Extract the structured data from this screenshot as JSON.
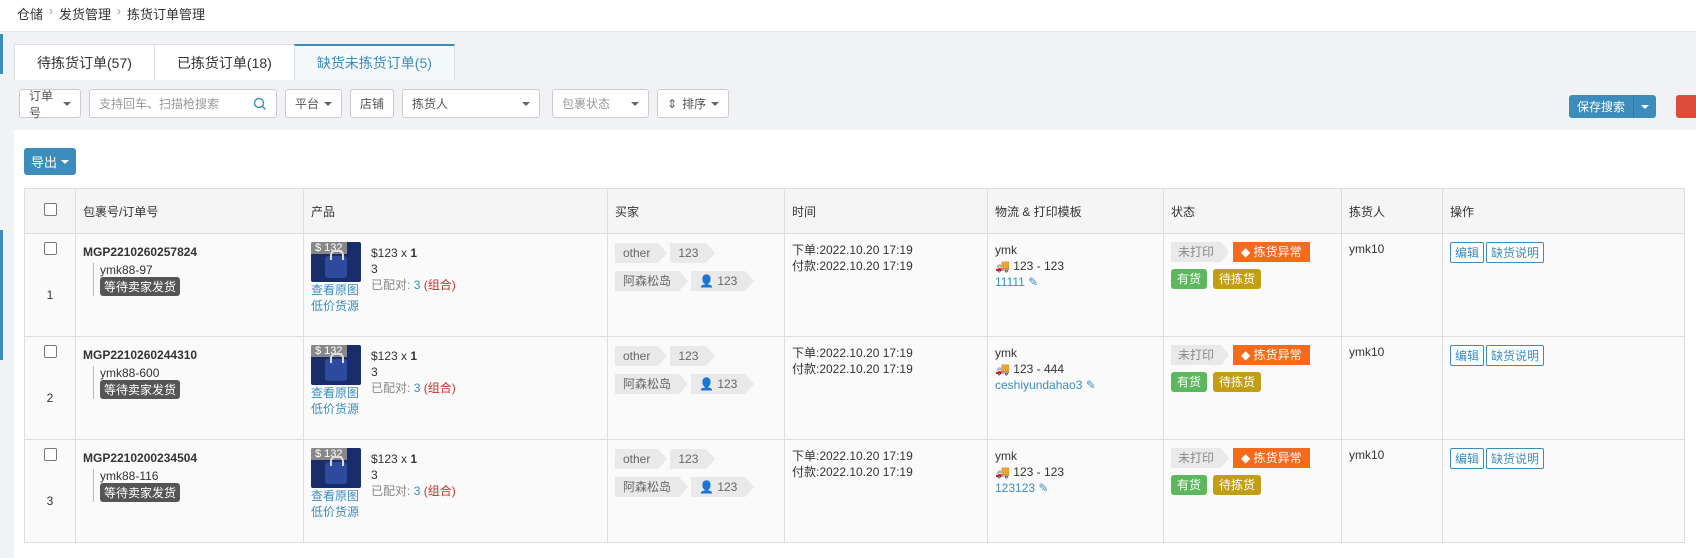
{
  "breadcrumb": [
    "仓储",
    "发货管理",
    "拣货订单管理"
  ],
  "tabs": [
    {
      "label": "待拣货订单(57)",
      "active": false
    },
    {
      "label": "已拣货订单(18)",
      "active": false
    },
    {
      "label": "缺货未拣货订单(5)",
      "active": true
    }
  ],
  "filters": {
    "order_no": "订单号",
    "search_placeholder": "支持回车、扫描枪搜索",
    "platform": "平台",
    "shop": "店铺",
    "picker": "拣货人",
    "package_status": "包裹状态",
    "sort": "排序"
  },
  "save_search": "保存搜索",
  "export": "导出",
  "columns": [
    "包裹号/订单号",
    "产品",
    "买家",
    "时间",
    "物流 & 打印模板",
    "状态",
    "拣货人",
    "操作"
  ],
  "rows": [
    {
      "index": "1",
      "package_no": "MGP2210260257824",
      "order_no": "ymk88-97",
      "order_status": "等待卖家发货",
      "price_tag": "$ 132",
      "unit_price": "$123",
      "times": "x",
      "qty": "1",
      "stock": "3",
      "matched_label": "已配对:",
      "matched_count": "3",
      "matched_type": "(组合)",
      "view_image": "查看原图",
      "low_price": "低价货源",
      "buyer_tag1": "other",
      "buyer_tag2": "123",
      "buyer_name": "阿森松岛",
      "buyer_id": "123",
      "order_time": "下单:2022.10.20 17:19",
      "pay_time": "付款:2022.10.20 17:19",
      "carrier": "ymk",
      "route": "123 - 123",
      "tracking": "11111",
      "print_status": "未打印",
      "exception": "拣货异常",
      "stock_status": "有货",
      "pick_status": "待拣货",
      "picker": "ymk10",
      "edit": "编辑",
      "note": "缺货说明"
    },
    {
      "index": "2",
      "package_no": "MGP2210260244310",
      "order_no": "ymk88-600",
      "order_status": "等待卖家发货",
      "price_tag": "$ 132",
      "unit_price": "$123",
      "times": "x",
      "qty": "1",
      "stock": "3",
      "matched_label": "已配对:",
      "matched_count": "3",
      "matched_type": "(组合)",
      "view_image": "查看原图",
      "low_price": "低价货源",
      "buyer_tag1": "other",
      "buyer_tag2": "123",
      "buyer_name": "阿森松岛",
      "buyer_id": "123",
      "order_time": "下单:2022.10.20 17:19",
      "pay_time": "付款:2022.10.20 17:19",
      "carrier": "ymk",
      "route": "123 - 444",
      "tracking": "ceshiyundahao3",
      "print_status": "未打印",
      "exception": "拣货异常",
      "stock_status": "有货",
      "pick_status": "待拣货",
      "picker": "ymk10",
      "edit": "编辑",
      "note": "缺货说明"
    },
    {
      "index": "3",
      "package_no": "MGP2210200234504",
      "order_no": "ymk88-116",
      "order_status": "等待卖家发货",
      "price_tag": "$ 132",
      "unit_price": "$123",
      "times": "x",
      "qty": "1",
      "stock": "3",
      "matched_label": "已配对:",
      "matched_count": "3",
      "matched_type": "(组合)",
      "view_image": "查看原图",
      "low_price": "低价货源",
      "buyer_tag1": "other",
      "buyer_tag2": "123",
      "buyer_name": "阿森松岛",
      "buyer_id": "123",
      "order_time": "下单:2022.10.20 17:19",
      "pay_time": "付款:2022.10.20 17:19",
      "carrier": "ymk",
      "route": "123 - 123",
      "tracking": "123123",
      "print_status": "未打印",
      "exception": "拣货异常",
      "stock_status": "有货",
      "pick_status": "待拣货",
      "picker": "ymk10",
      "edit": "编辑",
      "note": "缺货说明"
    }
  ],
  "colors": {
    "primary": "#3c8dbc",
    "exception": "#f56a1b",
    "in_stock": "#5cb85c",
    "pending": "#c29d16",
    "danger": "#dd4b39"
  }
}
